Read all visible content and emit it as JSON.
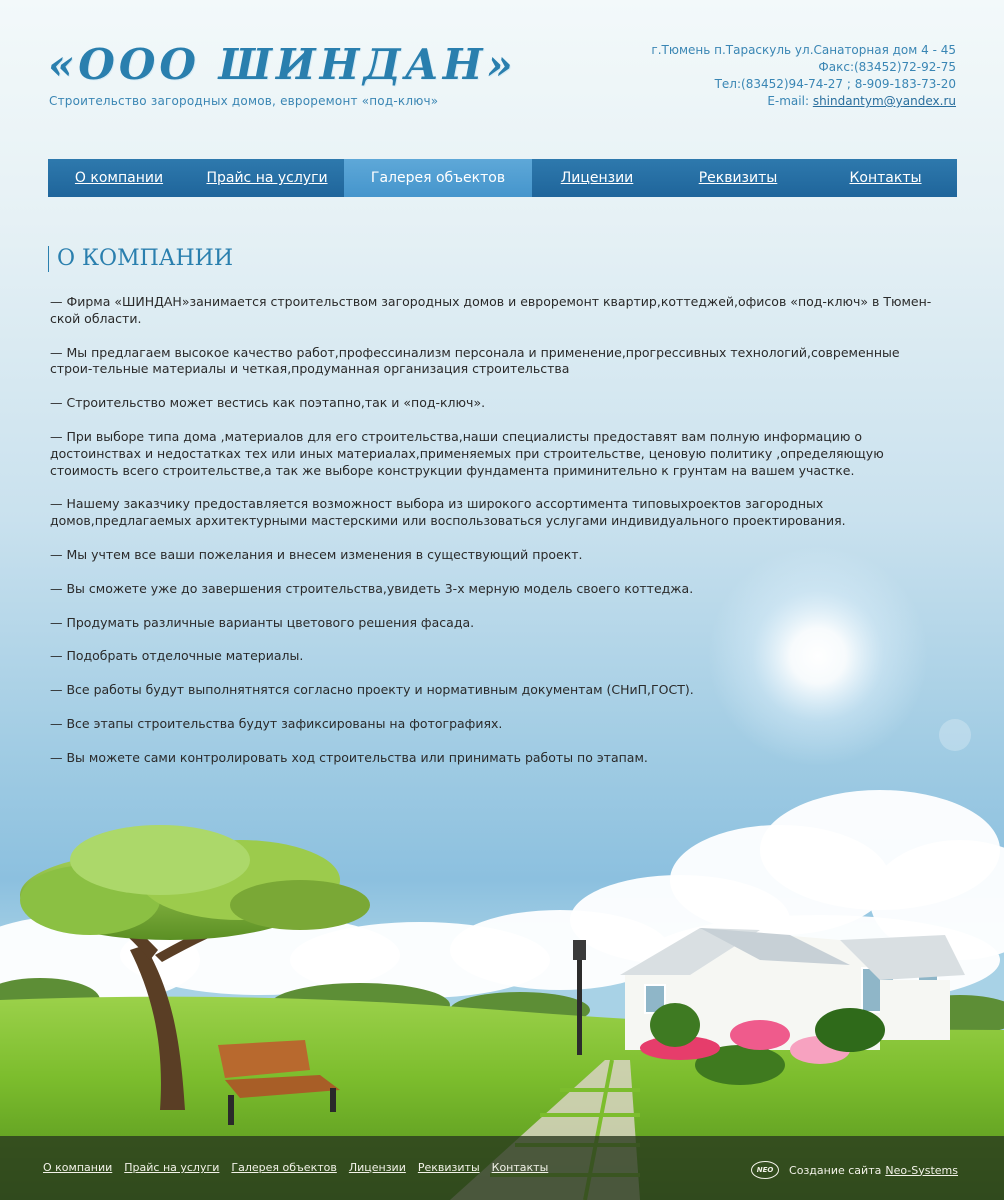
{
  "header": {
    "logo": "«ООО ШИНДАН»",
    "tagline": "Строительство загородных домов, евроремонт «под-ключ»",
    "address": "г.Тюмень п.Тараскуль ул.Санаторная дом 4 - 45",
    "fax": "Факс:(83452)72-92-75",
    "phone": "Тел:(83452)94-74-27 ; 8-909-183-73-20",
    "email_label": "E-mail: ",
    "email": "shindantym@yandex.ru"
  },
  "nav": {
    "items": [
      {
        "label": "О компании"
      },
      {
        "label": "Прайс на услуги"
      },
      {
        "label": "Галерея объектов",
        "active": true
      },
      {
        "label": "Лицензии"
      },
      {
        "label": "Реквизиты"
      },
      {
        "label": "Контакты"
      }
    ]
  },
  "main": {
    "title": "О КОМПАНИИ",
    "paragraphs": [
      "— Фирма «ШИНДАН»занимается строительством загородных домов и евроремонт квартир,коттеджей,офисов «под-ключ» в Тюмен-ской области.",
      "— Мы предлагаем высокое качество работ,профессинализм персонала и применение,прогрессивных технологий,современные строи-тельные материалы и четкая,продуманная организация строительства",
      "— Строительство может вестись как поэтапно,так и «под-ключ».",
      "— При выборе типа дома ,материалов для его строительства,наши специалисты предоставят вам полную информацию о достоинствах и недостатках тех или иных материалах,применяемых при строительстве, ценовую политику ,определяющую стоимость всего строительстве,а так же выборе конструкции фундамента приминительно к грунтам на вашем участке.",
      "— Нашему заказчику предоставляется возможност выбора из широкого ассортимента типовыхроектов загородных домов,предлагаемых архитектурными мастерскими или воспользоваться услугами индивидуального проектирования.",
      "— Мы учтем все ваши пожелания и внесем изменения в существующий проект.",
      "— Вы сможете уже до завершения строительства,увидеть 3-х мерную модель своего коттеджа.",
      "— Продумать различные варианты цветового решения фасада.",
      "— Подобрать отделочные материалы.",
      "— Все работы будут выполнятнятся согласно проекту и нормативным документам (СНиП,ГОСТ).",
      "— Все этапы строительства будут зафиксированы на фотографиях.",
      "— Вы можете сами контролировать ход строительства или принимать работы по этапам."
    ]
  },
  "footer": {
    "links": [
      "О компании",
      "Прайс на услуги",
      "Галерея объектов",
      "Лицензии",
      "Реквизиты",
      "Контакты"
    ],
    "credit_prefix": "Создание сайта",
    "credit_link": "Neo-Systems",
    "neo_logo_text": "NEO"
  }
}
